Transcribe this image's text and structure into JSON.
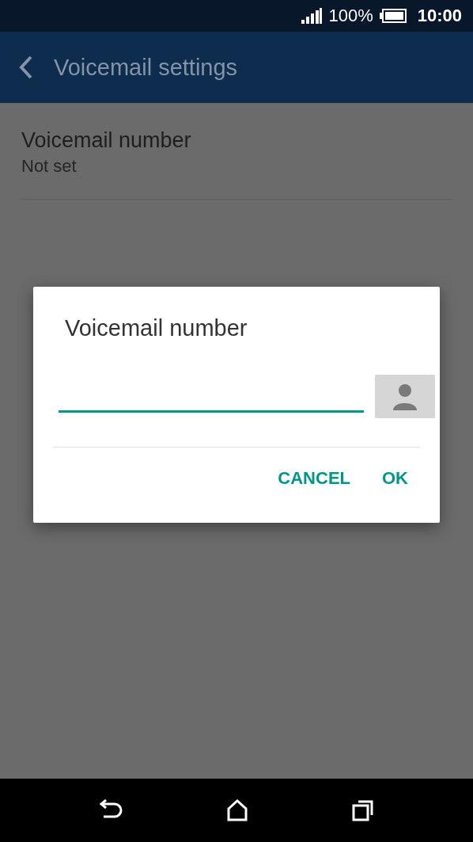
{
  "status_bar": {
    "battery": "100%",
    "time": "10:00"
  },
  "app_bar": {
    "title": "Voicemail settings"
  },
  "settings": [
    {
      "title": "Voicemail number",
      "summary": "Not set"
    }
  ],
  "dialog": {
    "title": "Voicemail number",
    "buttons": [
      "CANCEL",
      "OK"
    ]
  }
}
